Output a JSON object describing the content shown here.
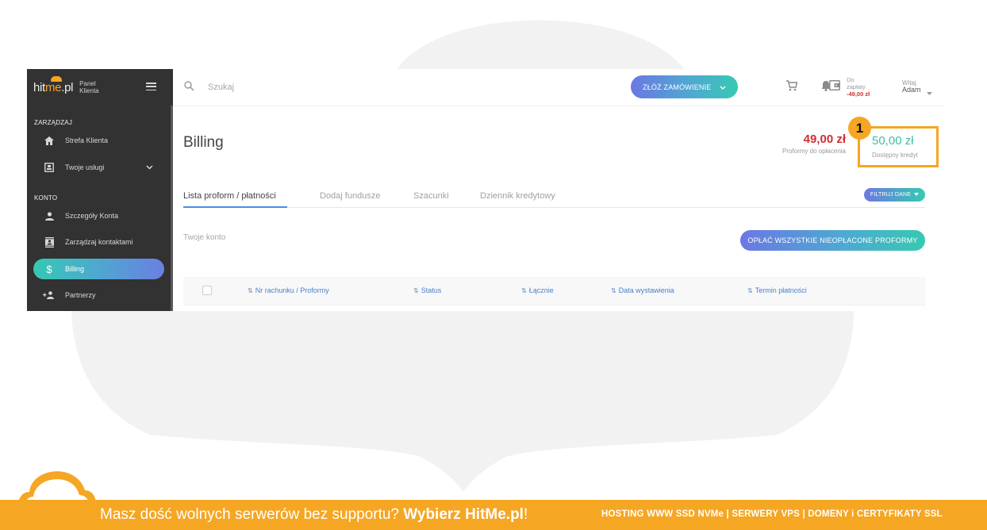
{
  "logo": {
    "brand_a": "hit",
    "brand_b": "me",
    "brand_c": ".pl",
    "sub_line1": "Panel",
    "sub_line2": "Klienta"
  },
  "sidebar": {
    "sections": [
      {
        "title": "ZARZĄDZAJ"
      },
      {
        "title": "KONTO"
      }
    ],
    "items": [
      {
        "label": "Strefa Klienta",
        "icon": "home-icon"
      },
      {
        "label": "Twoje usługi",
        "icon": "services-icon"
      },
      {
        "label": "Szczegóły Konta",
        "icon": "person-icon"
      },
      {
        "label": "Zarządzaj kontaktami",
        "icon": "contacts-icon"
      },
      {
        "label": "Billing",
        "icon": "dollar-icon",
        "active": true
      },
      {
        "label": "Partnerzy",
        "icon": "partners-icon"
      }
    ]
  },
  "topbar": {
    "search_placeholder": "Szukaj",
    "order_button": "ZŁÓŻ ZAMÓWIENIE",
    "due_line1": "Do",
    "due_line2": "zapłaty",
    "due_amount": "-49,00 zł",
    "greeting": "Witaj",
    "username": "Adam"
  },
  "billing": {
    "title": "Billing",
    "due_value": "49,00 zł",
    "due_label": "Proformy do opłacenia",
    "credit_value": "50,00 zł",
    "credit_label": "Dostępny kredyt",
    "marker": "1"
  },
  "tabs": [
    {
      "label": "Lista proform / płatności",
      "active": true
    },
    {
      "label": "Dodaj fundusze"
    },
    {
      "label": "Szacunki"
    },
    {
      "label": "Dziennik kredytowy"
    }
  ],
  "filter_button": "FILTRUJ DANE",
  "account_label": "Twoje konto",
  "pay_all_button": "OPŁAĆ WSZYSTKIE NIEOPŁACONE PROFORMY",
  "table": {
    "columns": [
      "Nr rachunku / Proformy",
      "Status",
      "Łącznie",
      "Data wystawienia",
      "Termin płatności"
    ]
  },
  "footer": {
    "promo_text": "Masz dość wolnych serwerów bez supportu? ",
    "promo_bold": "Wybierz HitMe.pl",
    "promo_end": "!",
    "services": "HOSTING WWW SSD NVMe | SERWERY VPS | DOMENY i CERTYFIKATY SSL"
  },
  "colors": {
    "accent_orange": "#f5a623",
    "gradient_start": "#6b78e2",
    "gradient_end": "#37c9b2",
    "due_red": "#d32f2f",
    "credit_teal": "#3cbfa9",
    "sidebar_bg": "#323232"
  }
}
